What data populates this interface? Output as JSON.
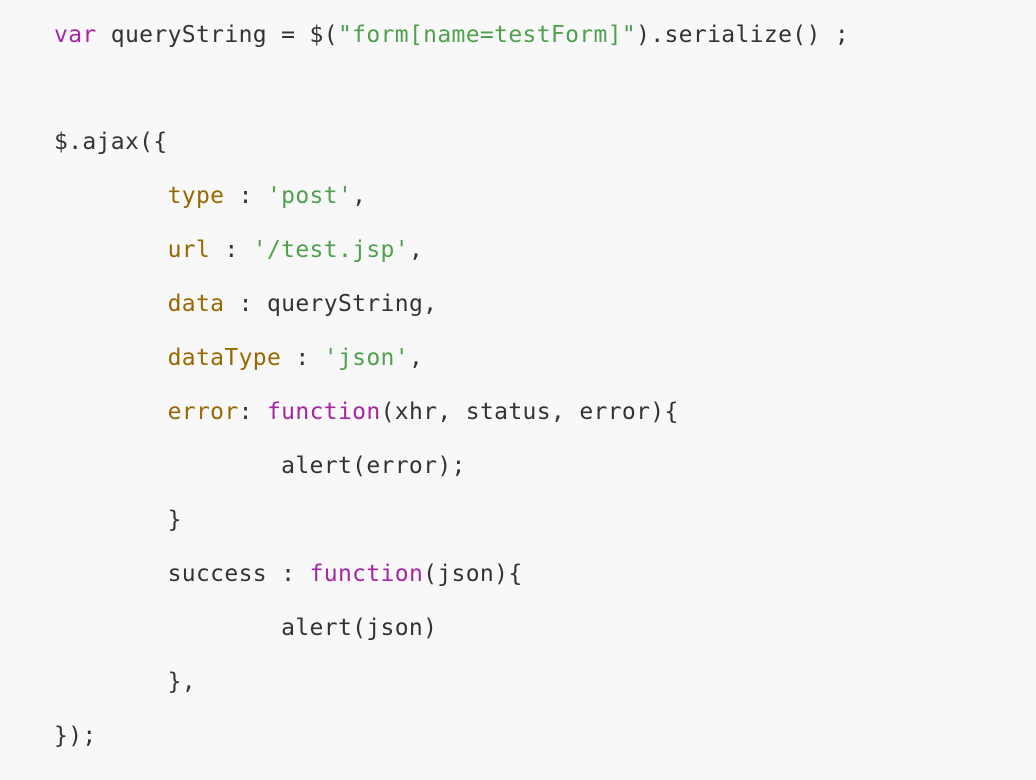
{
  "code": {
    "language": "javascript",
    "colors": {
      "background": "#f8f8f8",
      "plain": "#333333",
      "keyword": "#a626a4",
      "string": "#50a14f",
      "property": "#986801"
    },
    "lines": [
      {
        "tokens": [
          {
            "text": "var",
            "kind": "kw"
          },
          {
            "text": " queryString = $(",
            "kind": "plain"
          },
          {
            "text": "\"form[name=testForm]\"",
            "kind": "str"
          },
          {
            "text": ").serialize() ;",
            "kind": "plain"
          }
        ]
      },
      {
        "tokens": []
      },
      {
        "tokens": [
          {
            "text": "$.ajax({",
            "kind": "plain"
          }
        ]
      },
      {
        "tokens": [
          {
            "text": "        ",
            "kind": "plain"
          },
          {
            "text": "type",
            "kind": "prop"
          },
          {
            "text": " : ",
            "kind": "plain"
          },
          {
            "text": "'post'",
            "kind": "str"
          },
          {
            "text": ",",
            "kind": "plain"
          }
        ]
      },
      {
        "tokens": [
          {
            "text": "        ",
            "kind": "plain"
          },
          {
            "text": "url",
            "kind": "prop"
          },
          {
            "text": " : ",
            "kind": "plain"
          },
          {
            "text": "'/test.jsp'",
            "kind": "str"
          },
          {
            "text": ",",
            "kind": "plain"
          }
        ]
      },
      {
        "tokens": [
          {
            "text": "        ",
            "kind": "plain"
          },
          {
            "text": "data",
            "kind": "prop"
          },
          {
            "text": " : queryString,",
            "kind": "plain"
          }
        ]
      },
      {
        "tokens": [
          {
            "text": "        ",
            "kind": "plain"
          },
          {
            "text": "dataType",
            "kind": "prop"
          },
          {
            "text": " : ",
            "kind": "plain"
          },
          {
            "text": "'json'",
            "kind": "str"
          },
          {
            "text": ",",
            "kind": "plain"
          }
        ]
      },
      {
        "tokens": [
          {
            "text": "        ",
            "kind": "plain"
          },
          {
            "text": "error",
            "kind": "prop"
          },
          {
            "text": ": ",
            "kind": "plain"
          },
          {
            "text": "function",
            "kind": "kw"
          },
          {
            "text": "(xhr, status, error){",
            "kind": "plain"
          }
        ]
      },
      {
        "tokens": [
          {
            "text": "                alert(error);",
            "kind": "plain"
          }
        ]
      },
      {
        "tokens": [
          {
            "text": "        }",
            "kind": "plain"
          }
        ]
      },
      {
        "tokens": [
          {
            "text": "        success : ",
            "kind": "plain"
          },
          {
            "text": "function",
            "kind": "kw"
          },
          {
            "text": "(json){",
            "kind": "plain"
          }
        ]
      },
      {
        "tokens": [
          {
            "text": "                alert(json)",
            "kind": "plain"
          }
        ]
      },
      {
        "tokens": [
          {
            "text": "        },",
            "kind": "plain"
          }
        ]
      },
      {
        "tokens": [
          {
            "text": "});",
            "kind": "plain"
          }
        ]
      }
    ]
  }
}
